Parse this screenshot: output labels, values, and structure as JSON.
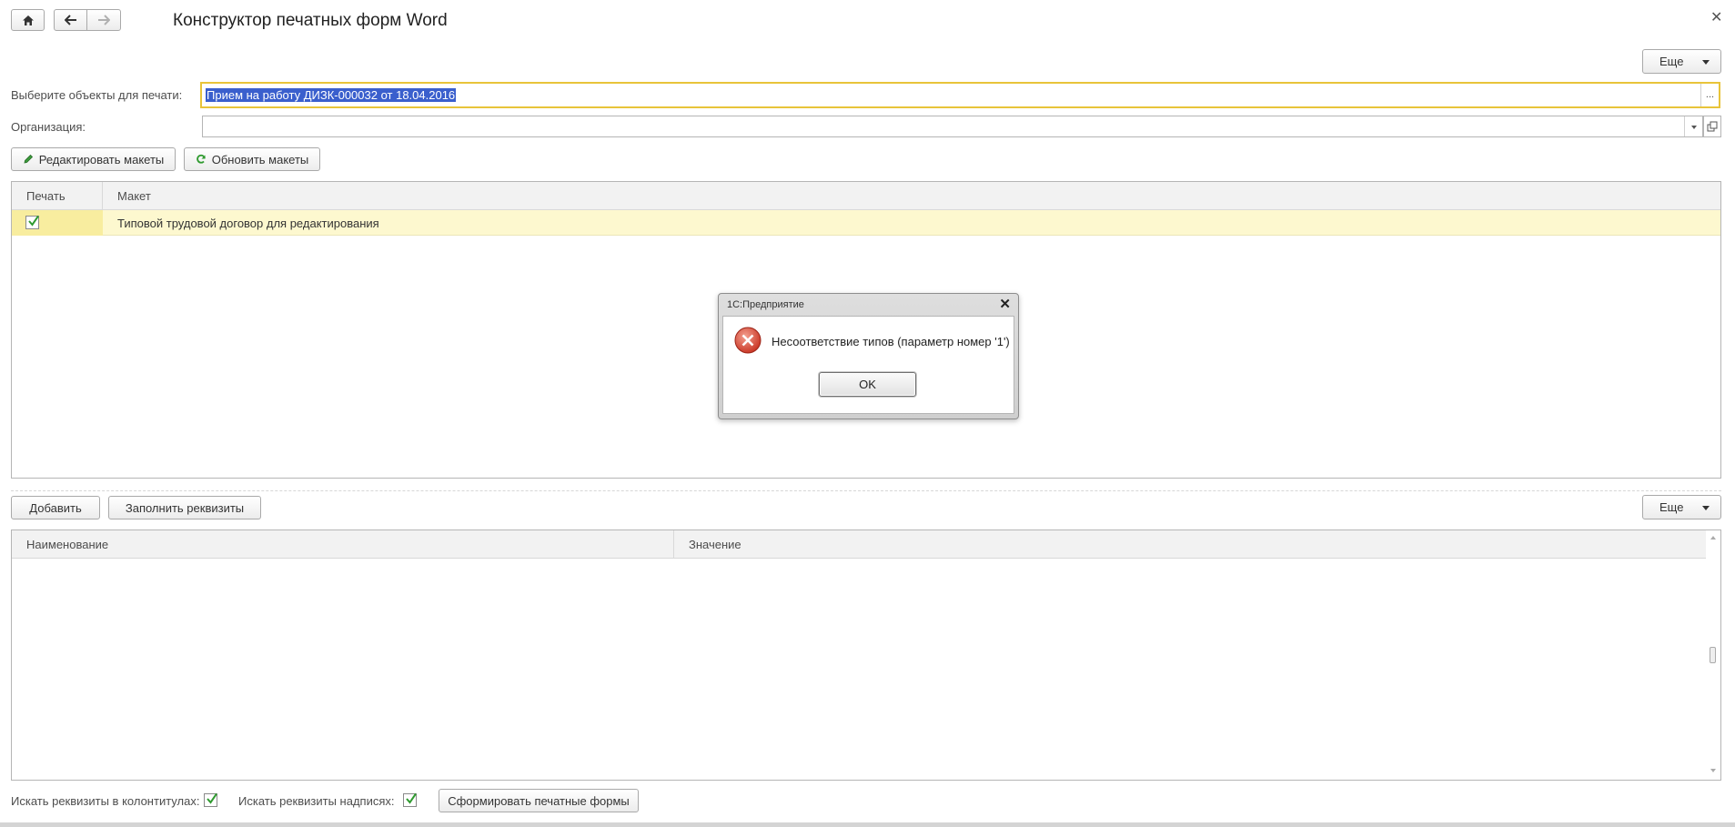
{
  "window": {
    "title": "Конструктор печатных форм Word"
  },
  "toolbar": {
    "more_label": "Еще",
    "edit_templates_label": "Редактировать макеты",
    "refresh_templates_label": "Обновить макеты"
  },
  "form": {
    "objects_label": "Выберите объекты для печати:",
    "objects_value": "Прием на работу ДИЗК-000032 от 18.04.2016",
    "org_label": "Организация:",
    "org_value": "",
    "ellipsis": "..."
  },
  "templates_table": {
    "columns": [
      "Печать",
      "Макет"
    ],
    "rows": [
      {
        "print": true,
        "template": "Типовой трудовой договор для редактирования"
      }
    ]
  },
  "dialog": {
    "title": "1С:Предприятие",
    "message": "Несоответствие типов (параметр номер '1')",
    "ok_label": "OK"
  },
  "props_toolbar": {
    "add_label": "Добавить",
    "fill_label": "Заполнить реквизиты",
    "more_label": "Еще"
  },
  "props_table": {
    "columns": [
      "Наименование",
      "Значение"
    ],
    "rows": []
  },
  "footer": {
    "search_headers_label": "Искать реквизиты в колонтитулах:",
    "search_headers_checked": true,
    "search_labels_label": "Искать реквизиты надписях:",
    "search_labels_checked": true,
    "generate_label": "Сформировать печатные формы"
  },
  "colors": {
    "selected_row": "#fdf8cf",
    "field_focus": "#e8c43a",
    "selection": "#3a5fcd",
    "checkmark": "#2f9a2f",
    "error_icon": "#d93b2e"
  }
}
